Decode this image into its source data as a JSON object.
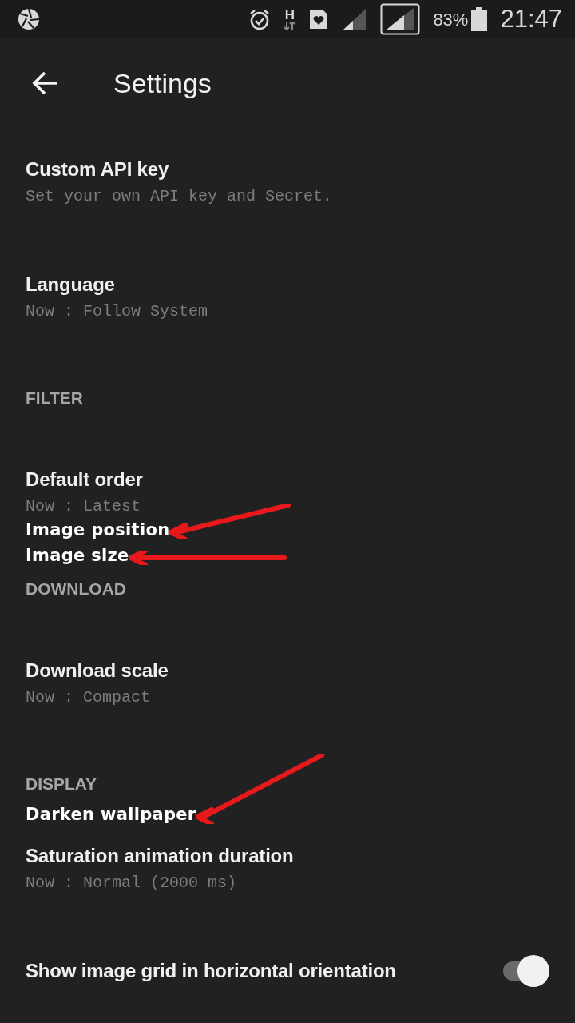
{
  "status_bar": {
    "battery": "83%",
    "time": "21:47",
    "network": "H"
  },
  "toolbar": {
    "title": "Settings"
  },
  "items": [
    {
      "kind": "pref",
      "title": "Custom API key",
      "summary": "Set your own API key and Secret."
    },
    {
      "kind": "pref",
      "title": "Language",
      "summary": "Now : Follow System"
    },
    {
      "kind": "header",
      "title": "FILTER"
    },
    {
      "kind": "pref",
      "title": "Default order",
      "summary": "Now : Latest"
    },
    {
      "kind": "note",
      "title": "Image position",
      "arrow": true
    },
    {
      "kind": "note",
      "title": "Image size",
      "arrow": true
    },
    {
      "kind": "header",
      "title": "DOWNLOAD"
    },
    {
      "kind": "pref",
      "title": "Download scale",
      "summary": "Now : Compact"
    },
    {
      "kind": "header",
      "title": "DISPLAY"
    },
    {
      "kind": "note",
      "title": "Darken wallpaper",
      "arrow": true
    },
    {
      "kind": "pref",
      "title": "Saturation animation duration",
      "summary": "Now : Normal (2000 ms)"
    },
    {
      "kind": "switch",
      "title": "Show image grid in horizontal orientation",
      "on": true
    }
  ]
}
